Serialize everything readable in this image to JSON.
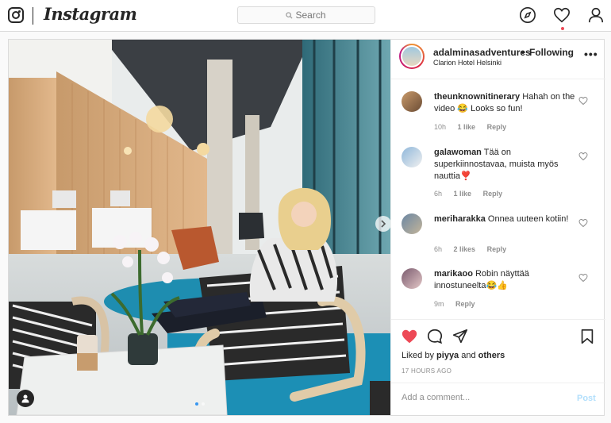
{
  "topbar": {
    "brand": "Instagram",
    "search_placeholder": "Search",
    "icons": [
      "instagram-logo-icon",
      "compass-icon",
      "heart-icon",
      "profile-icon"
    ]
  },
  "post": {
    "username": "adalminasadventures",
    "separator": "•",
    "follow_state": "Following",
    "location": "Clarion Hotel Helsinki",
    "more": "•••",
    "carousel": {
      "current": 1,
      "total": 2
    },
    "comments": [
      {
        "user": "theunknownitinerary",
        "text": "Hahah on the video 😂 Looks so fun!",
        "time": "10h",
        "likes": "1 like",
        "reply": "Reply"
      },
      {
        "user": "galawoman",
        "text": "Tää on superkiinnostavaa, muista myös nauttia❣️",
        "time": "6h",
        "likes": "1 like",
        "reply": "Reply"
      },
      {
        "user": "meriharakka",
        "text": "Onnea uuteen kotiin!",
        "time": "6h",
        "likes": "2 likes",
        "reply": "Reply"
      },
      {
        "user": "marikaoo",
        "text": "Robin näyttää innostuneelta😂👍",
        "time": "9m",
        "likes": "",
        "reply": "Reply"
      }
    ],
    "liked_by_prefix": "Liked by",
    "liked_by_user": "piyya",
    "liked_by_and": "and",
    "liked_by_others": "others",
    "timestamp": "17 HOURS AGO",
    "comment_placeholder": "Add a comment...",
    "post_button": "Post"
  },
  "colors": {
    "like_red": "#ed4956",
    "post_blue_disabled": "#b2dffc",
    "border": "#dbdbdb"
  }
}
